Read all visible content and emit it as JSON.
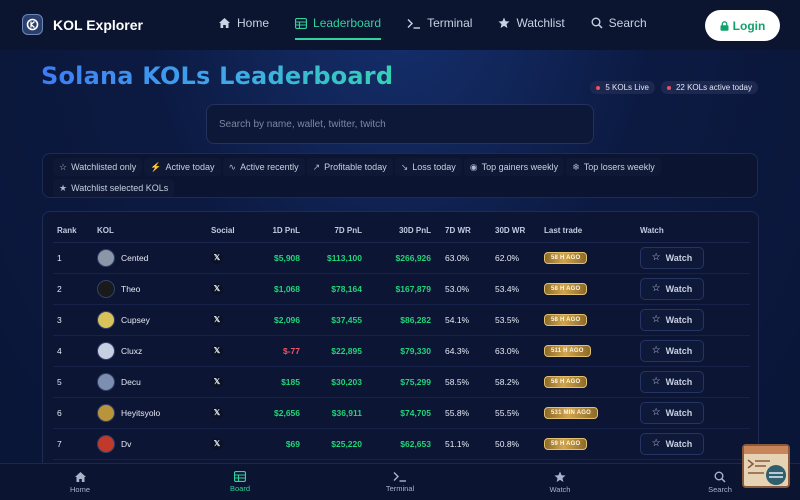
{
  "app": {
    "name": "KOL Explorer",
    "login_label": "Login"
  },
  "nav": [
    {
      "label": "Home",
      "icon": "home-icon",
      "active": false
    },
    {
      "label": "Leaderboard",
      "icon": "leaderboard-icon",
      "active": true
    },
    {
      "label": "Terminal",
      "icon": "terminal-icon",
      "active": false
    },
    {
      "label": "Watchlist",
      "icon": "star-icon",
      "active": false
    },
    {
      "label": "Search",
      "icon": "search-icon",
      "active": false
    }
  ],
  "page": {
    "title": "Solana KOLs Leaderboard",
    "badges": [
      "5 KOLs Live",
      "22 KOLs active today"
    ],
    "search_placeholder": "Search by name, wallet, twitter, twitch"
  },
  "filters": [
    {
      "icon": "☆",
      "label": "Watchlisted only"
    },
    {
      "icon": "⚡",
      "label": "Active today"
    },
    {
      "icon": "∿",
      "label": "Active recently"
    },
    {
      "icon": "↗",
      "label": "Profitable today"
    },
    {
      "icon": "↘",
      "label": "Loss today"
    },
    {
      "icon": "◉",
      "label": "Top gainers weekly"
    },
    {
      "icon": "❄",
      "label": "Top losers weekly"
    },
    {
      "icon": "★",
      "label": "Watchlist selected KOLs"
    }
  ],
  "table": {
    "columns": [
      "Rank",
      "KOL",
      "Social",
      "1D PnL",
      "7D PnL",
      "30D PnL",
      "7D WR",
      "30D WR",
      "Last trade",
      "Watch"
    ],
    "watch_label": "Watch",
    "rows": [
      {
        "rank": "1",
        "name": "Cented",
        "pnl_1d": "$5,908",
        "pnl_7d": "$113,100",
        "pnl_30d": "$266,926",
        "wr_7d": "63.0%",
        "wr_30d": "62.0%",
        "last_trade": "58 H AGO",
        "avatar_color": "#8a97a8",
        "pnl_1d_sign": "pos"
      },
      {
        "rank": "2",
        "name": "Theo",
        "pnl_1d": "$1,068",
        "pnl_7d": "$78,164",
        "pnl_30d": "$167,879",
        "wr_7d": "53.0%",
        "wr_30d": "53.4%",
        "last_trade": "58 H AGO",
        "avatar_color": "#1a1a1a",
        "pnl_1d_sign": "pos"
      },
      {
        "rank": "3",
        "name": "Cupsey",
        "pnl_1d": "$2,096",
        "pnl_7d": "$37,455",
        "pnl_30d": "$86,282",
        "wr_7d": "54.1%",
        "wr_30d": "53.5%",
        "last_trade": "58 H AGO",
        "avatar_color": "#d8c35a",
        "pnl_1d_sign": "pos"
      },
      {
        "rank": "4",
        "name": "Cluxz",
        "pnl_1d": "$-77",
        "pnl_7d": "$22,895",
        "pnl_30d": "$79,330",
        "wr_7d": "64.3%",
        "wr_30d": "63.0%",
        "last_trade": "511 H AGO",
        "avatar_color": "#c7d0e2",
        "pnl_1d_sign": "neg"
      },
      {
        "rank": "5",
        "name": "Decu",
        "pnl_1d": "$185",
        "pnl_7d": "$30,203",
        "pnl_30d": "$75,299",
        "wr_7d": "58.5%",
        "wr_30d": "58.2%",
        "last_trade": "58 H AGO",
        "avatar_color": "#7c8fb0",
        "pnl_1d_sign": "pos"
      },
      {
        "rank": "6",
        "name": "Heyitsyolo",
        "pnl_1d": "$2,656",
        "pnl_7d": "$36,911",
        "pnl_30d": "$74,705",
        "wr_7d": "55.8%",
        "wr_30d": "55.5%",
        "last_trade": "531 MIN AGO",
        "avatar_color": "#b8943a",
        "pnl_1d_sign": "pos"
      },
      {
        "rank": "7",
        "name": "Dv",
        "pnl_1d": "$69",
        "pnl_7d": "$25,220",
        "pnl_30d": "$62,653",
        "wr_7d": "51.1%",
        "wr_30d": "50.8%",
        "last_trade": "59 H AGO",
        "avatar_color": "#c0392b",
        "pnl_1d_sign": "pos"
      }
    ]
  },
  "bottom_nav": [
    {
      "label": "Home",
      "icon": "home-icon",
      "active": false
    },
    {
      "label": "Board",
      "icon": "board-icon",
      "active": true
    },
    {
      "label": "Terminal",
      "icon": "terminal-icon",
      "active": false
    },
    {
      "label": "Watch",
      "icon": "star-icon",
      "active": false
    },
    {
      "label": "Search",
      "icon": "search-icon",
      "active": false
    }
  ],
  "colors": {
    "accent": "#2fd39b",
    "positive": "#22d47a",
    "negative": "#f0556a",
    "badge_gold": "#d2a54d",
    "background": "#0c1a42"
  }
}
